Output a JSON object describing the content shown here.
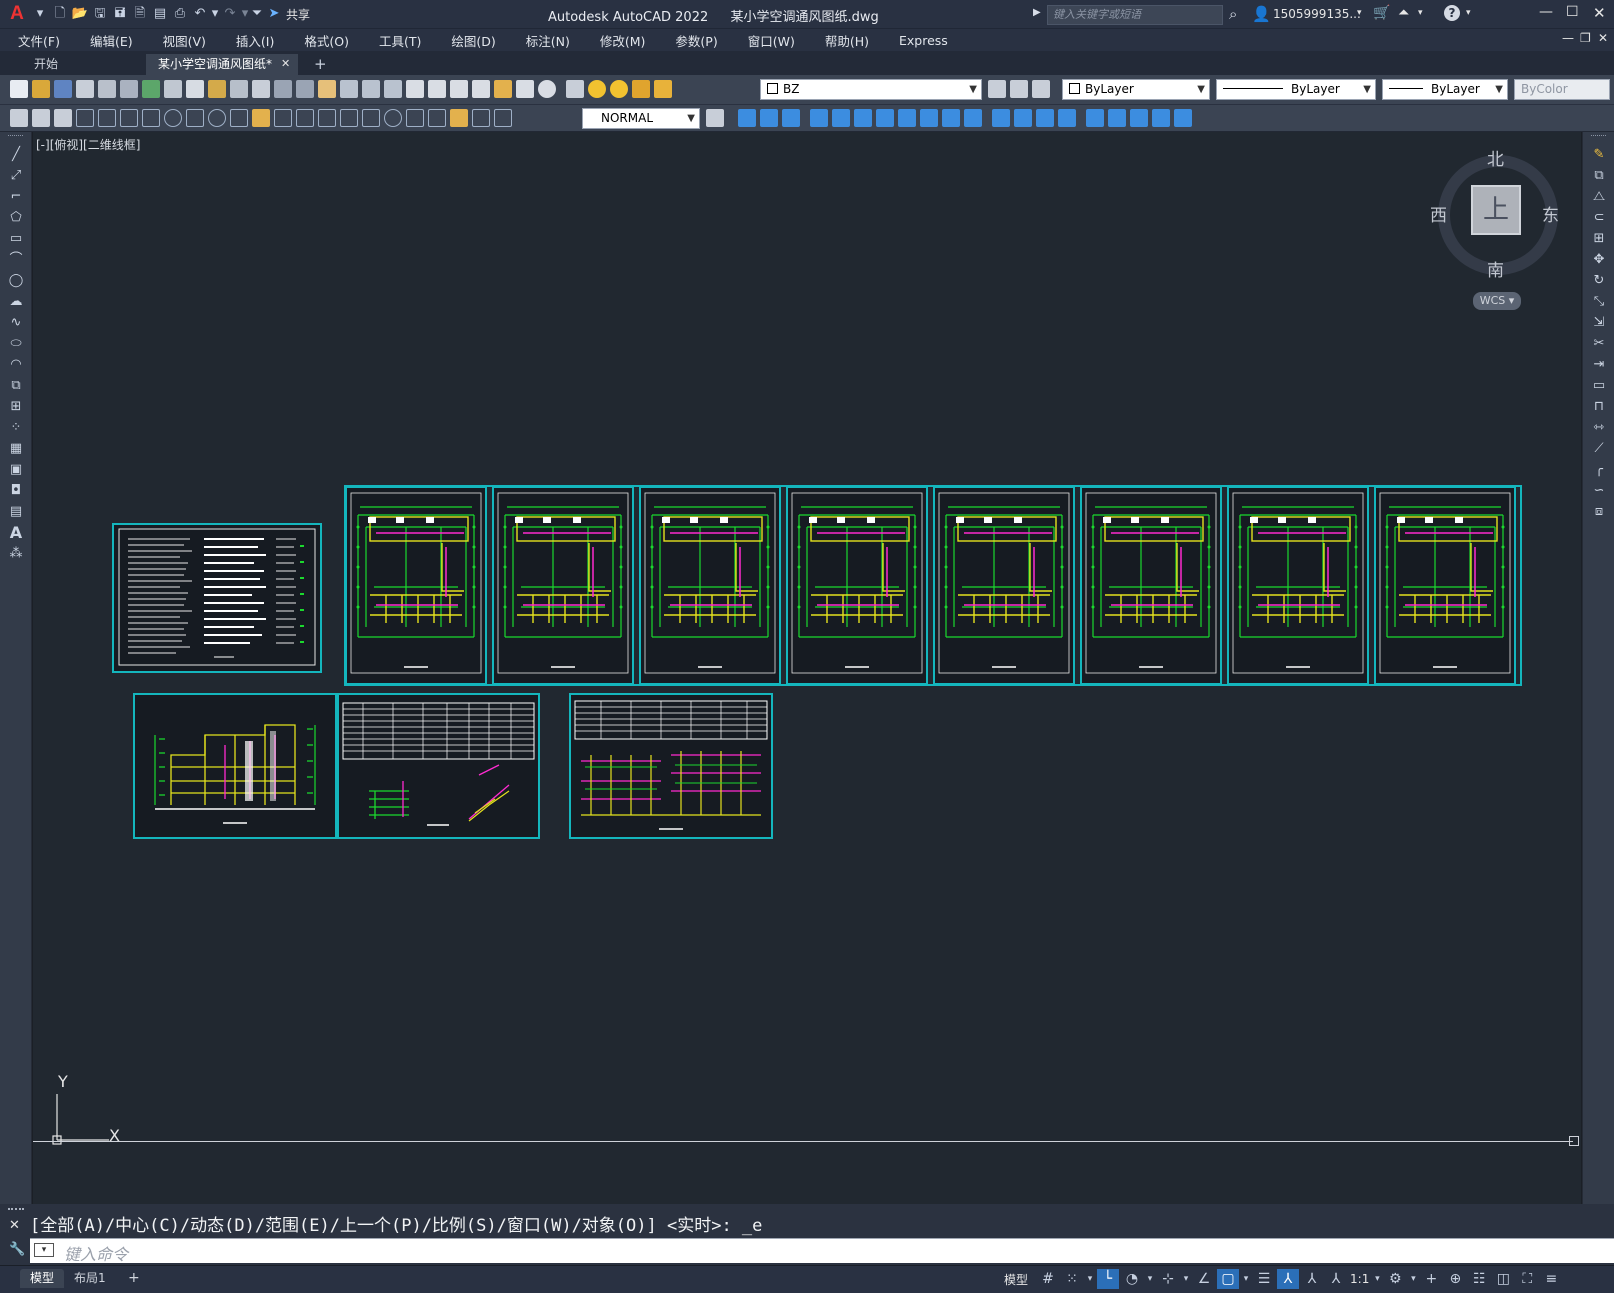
{
  "title_bar": {
    "app_name": "Autodesk AutoCAD 2022",
    "file_name": "某小学空调通风图纸.dwg",
    "share_label": "共享",
    "search_placeholder": "键入关键字或短语",
    "user": "1505999135..."
  },
  "menu": [
    "文件(F)",
    "编辑(E)",
    "视图(V)",
    "插入(I)",
    "格式(O)",
    "工具(T)",
    "绘图(D)",
    "标注(N)",
    "修改(M)",
    "参数(P)",
    "窗口(W)",
    "帮助(H)",
    "Express"
  ],
  "tabs": {
    "start": "开始",
    "active": "某小学空调通风图纸*",
    "close": "✕",
    "add": "+"
  },
  "toolbar": {
    "layer": "BZ",
    "color": "ByLayer",
    "linetype": "ByLayer",
    "lineweight": "ByLayer",
    "plotstyle": "ByColor",
    "textstyle": "NORMAL"
  },
  "viewport": {
    "label": "[-][俯视][二维线框]"
  },
  "viewcube": {
    "north": "北",
    "south": "南",
    "east": "东",
    "west": "西",
    "top": "上",
    "wcs": "WCS"
  },
  "ucs": {
    "x": "X",
    "y": "Y"
  },
  "command": {
    "history": "[全部(A)/中心(C)/动态(D)/范围(E)/上一个(P)/比例(S)/窗口(W)/对象(O)] <实时>: _e",
    "placeholder": "键入命令"
  },
  "status": {
    "model_tab": "模型",
    "layout_tab": "布局1",
    "add": "+",
    "model_label": "模型",
    "scale": "1:1"
  },
  "colors": {
    "sheet_border": "#14b6bd",
    "accent": "#2b6fb8",
    "green_lines": "#1bd92e",
    "yellow_lines": "#e4e21e",
    "magenta_lines": "#ff2bd0"
  }
}
